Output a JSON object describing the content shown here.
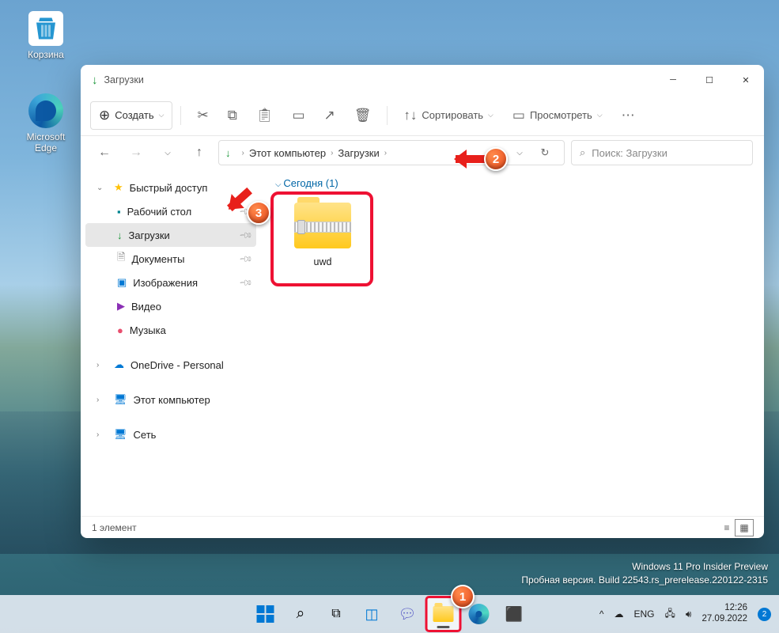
{
  "desktop": {
    "recycle_bin": "Корзина",
    "edge": "Microsoft Edge"
  },
  "window": {
    "title": "Загрузки",
    "toolbar": {
      "new": "Создать",
      "sort": "Сортировать",
      "view": "Просмотреть"
    },
    "breadcrumb": {
      "pc": "Этот компьютер",
      "dl": "Загрузки"
    },
    "search": {
      "placeholder": "Поиск: Загрузки"
    },
    "sidebar": {
      "quick": "Быстрый доступ",
      "desktop": "Рабочий стол",
      "downloads": "Загрузки",
      "documents": "Документы",
      "pictures": "Изображения",
      "videos": "Видео",
      "music": "Музыка",
      "onedrive": "OneDrive - Personal",
      "this_pc": "Этот компьютер",
      "network": "Сеть"
    },
    "group": "Сегодня (1)",
    "file": "uwd",
    "status": "1 элемент"
  },
  "watermark": {
    "l1": "Windows 11 Pro Insider Preview",
    "l2": "Пробная версия. Build 22543.rs_prerelease.220122-2315"
  },
  "tray": {
    "lang": "ENG",
    "time": "12:26",
    "date": "27.09.2022",
    "notif": "2"
  },
  "markers": {
    "m1": "1",
    "m2": "2",
    "m3": "3"
  }
}
